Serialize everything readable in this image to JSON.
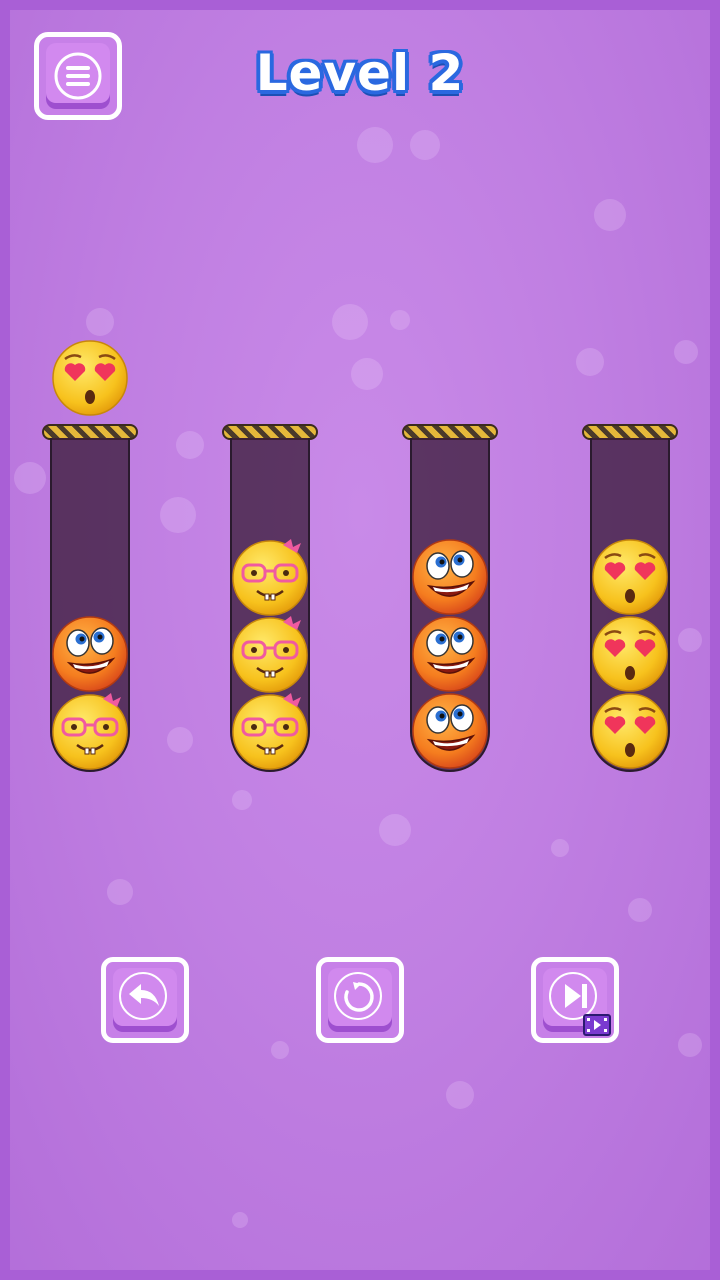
{
  "level_title": "Level 2",
  "colors": {
    "background": "#c07fe2",
    "button": "#c780e8",
    "title_outline": "#2a68e0"
  },
  "held_ball": "heart-eyes",
  "tubes": [
    {
      "balls": [
        "nerd",
        "laughing"
      ]
    },
    {
      "balls": [
        "nerd",
        "nerd",
        "nerd"
      ]
    },
    {
      "balls": [
        "laughing",
        "laughing",
        "laughing"
      ]
    },
    {
      "balls": [
        "heart-eyes",
        "heart-eyes",
        "heart-eyes"
      ]
    }
  ],
  "controls": {
    "menu_icon": "hamburger-menu-icon",
    "undo_icon": "undo-arrow-icon",
    "restart_icon": "restart-icon",
    "skip_icon": "skip-video-icon"
  }
}
